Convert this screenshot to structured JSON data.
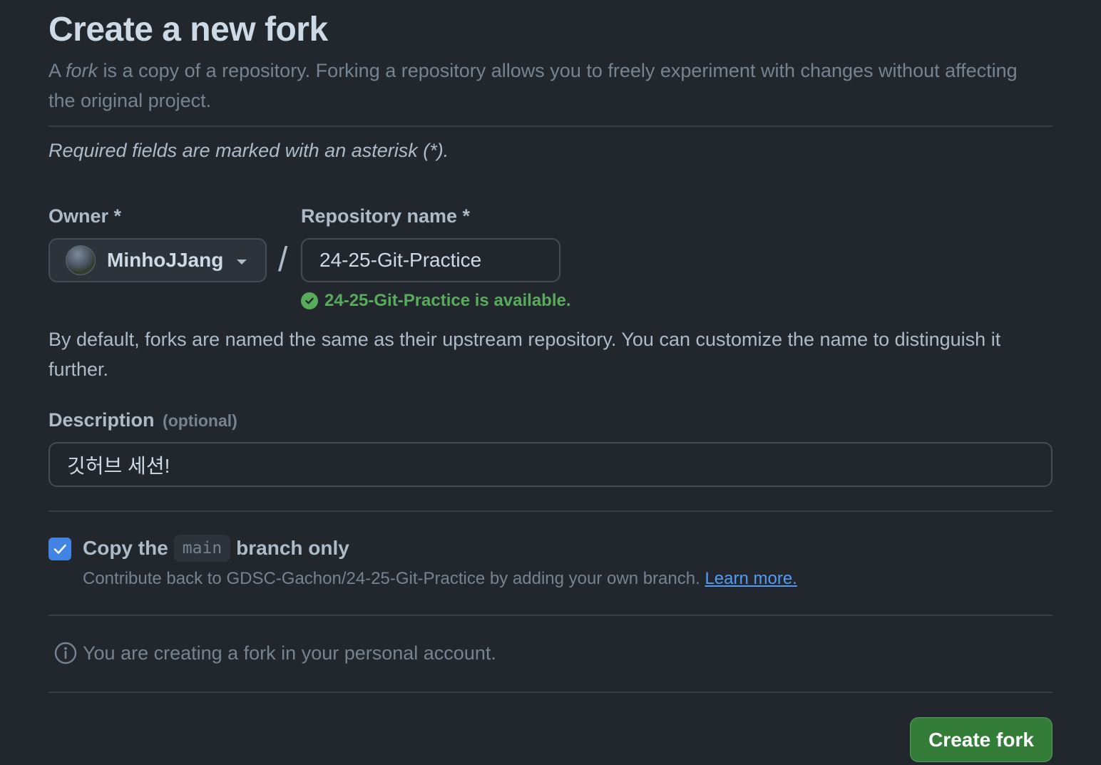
{
  "header": {
    "title": "Create a new fork",
    "subtitle_prefix": "A ",
    "subtitle_em": "fork",
    "subtitle_rest": " is a copy of a repository. Forking a repository allows you to freely experiment with changes without affecting the original project."
  },
  "required_note": "Required fields are marked with an asterisk (*).",
  "owner": {
    "label": "Owner *",
    "value": "MinhoJJang"
  },
  "separator": "/",
  "repository": {
    "label": "Repository name *",
    "value": "24-25-Git-Practice",
    "availability": "24-25-Git-Practice is available."
  },
  "naming_help": "By default, forks are named the same as their upstream repository. You can customize the name to distinguish it further.",
  "description": {
    "label": "Description",
    "optional": "(optional)",
    "value": "깃허브 세션!"
  },
  "copy_branch": {
    "checked": true,
    "label_before": "Copy the",
    "branch": "main",
    "label_after": "branch only",
    "description": "Contribute back to GDSC-Gachon/24-25-Git-Practice by adding your own branch.",
    "learn_more": "Learn more."
  },
  "info": {
    "text": "You are creating a fork in your personal account.",
    "icon": "info-icon"
  },
  "submit": {
    "label": "Create fork"
  },
  "colors": {
    "background": "#22272e",
    "accent_blue": "#4184e4",
    "success_green": "#57ab5a",
    "button_green": "#347d39",
    "link": "#539bf5"
  }
}
